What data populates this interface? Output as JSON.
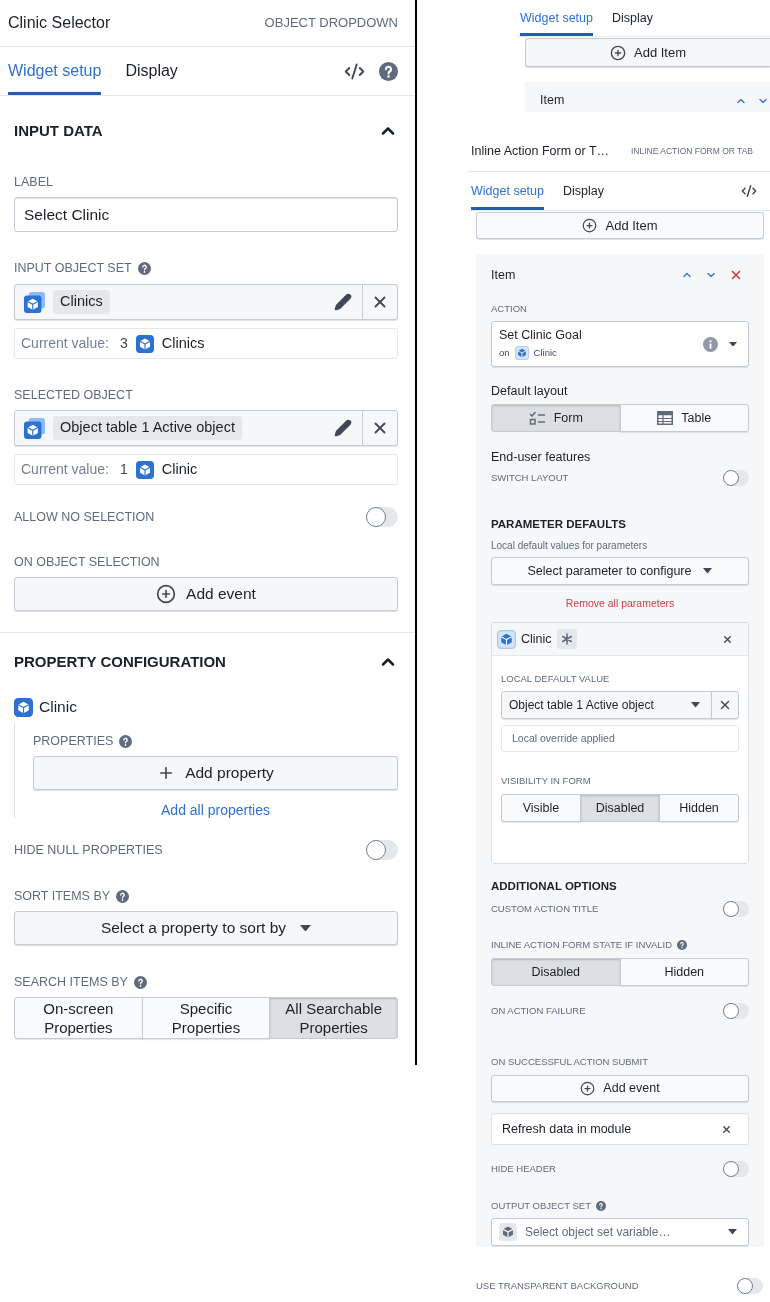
{
  "object_dropdown_panel": {
    "title": "Clinic Selector",
    "widget_type": "OBJECT DROPDOWN",
    "tabs": [
      {
        "label": "Widget setup",
        "selected": true
      },
      {
        "label": "Display",
        "selected": false
      }
    ],
    "input_data": {
      "heading": "INPUT DATA",
      "expanded": true,
      "label_field": {
        "label": "LABEL",
        "value": "Select Clinic"
      },
      "input_object_set": {
        "label": "INPUT OBJECT SET",
        "chip": "Clinics",
        "current_value_label": "Current value:",
        "current_count": "3",
        "current_object": "Clinics"
      },
      "selected_object": {
        "label": "SELECTED OBJECT",
        "chip": "Object table 1 Active object",
        "current_value_label": "Current value:",
        "current_count": "1",
        "current_object": "Clinic"
      },
      "allow_no_selection": {
        "label": "ALLOW NO SELECTION",
        "on": false
      },
      "on_object_selection": {
        "label": "ON OBJECT SELECTION",
        "button": "Add event"
      }
    },
    "property_configuration": {
      "heading": "PROPERTY CONFIGURATION",
      "expanded": true,
      "object_type": "Clinic",
      "properties_label": "PROPERTIES",
      "add_property_button": "Add property",
      "add_all_link": "Add all properties",
      "hide_null_properties": {
        "label": "HIDE NULL PROPERTIES",
        "on": false
      },
      "sort_items_by": {
        "label": "SORT ITEMS BY",
        "button": "Select a property to sort by"
      },
      "search_items_by": {
        "label": "SEARCH ITEMS BY",
        "options": [
          {
            "label": "On-screen Properties",
            "selected": false
          },
          {
            "label": "Specific Properties",
            "selected": false
          },
          {
            "label": "All Searchable Properties",
            "selected": true
          }
        ]
      }
    }
  },
  "partial_panel": {
    "tabs": [
      {
        "label": "Widget setup",
        "selected": true
      },
      {
        "label": "Display",
        "selected": false
      }
    ],
    "add_button": "Add Item",
    "item_title": "Item"
  },
  "action_form_panel": {
    "title": "Inline Action Form or T…",
    "widget_type": "INLINE ACTION FORM OR TAB",
    "tabs": [
      {
        "label": "Widget setup",
        "selected": true
      },
      {
        "label": "Display",
        "selected": false
      }
    ],
    "add_button": "Add Item",
    "item": {
      "title": "Item",
      "action": {
        "label": "ACTION",
        "name": "Set Clinic Goal",
        "on_label": "on",
        "object": "Clinic"
      },
      "default_layout": {
        "label": "Default layout",
        "options": [
          {
            "kind": "form",
            "label": "Form",
            "selected": true
          },
          {
            "kind": "table",
            "label": "Table",
            "selected": false
          }
        ]
      },
      "end_user_features": {
        "heading": "End-user features",
        "switch_layout": {
          "label": "SWITCH LAYOUT",
          "on": false
        }
      },
      "parameter_defaults": {
        "heading": "PARAMETER DEFAULTS",
        "description": "Local default values for parameters",
        "select_button": "Select parameter to configure",
        "remove_link": "Remove all parameters",
        "parameters": [
          {
            "name": "Clinic",
            "default_label": "LOCAL DEFAULT VALUE",
            "default_value": "Object table 1 Active object",
            "note": "Local override applied",
            "visibility_label": "VISIBILITY IN FORM",
            "visibility_options": [
              {
                "label": "Visible",
                "selected": false
              },
              {
                "label": "Disabled",
                "selected": true
              },
              {
                "label": "Hidden",
                "selected": false
              }
            ]
          }
        ]
      },
      "additional_options": {
        "heading": "ADDITIONAL OPTIONS",
        "custom_action_title": {
          "label": "CUSTOM ACTION TITLE",
          "on": false
        },
        "invalid_state": {
          "label": "INLINE ACTION FORM STATE IF INVALID",
          "options": [
            {
              "label": "Disabled",
              "selected": true
            },
            {
              "label": "Hidden",
              "selected": false
            }
          ]
        },
        "on_action_failure": {
          "label": "ON ACTION FAILURE",
          "on": false
        },
        "on_successful_submit": {
          "label": "ON SUCCESSFUL ACTION SUBMIT",
          "button": "Add event",
          "events": [
            "Refresh data in module"
          ]
        },
        "hide_header": {
          "label": "HIDE HEADER",
          "on": false
        },
        "output_object_set": {
          "label": "OUTPUT OBJECT SET",
          "placeholder": "Select object set variable…"
        }
      }
    },
    "transparent_background": {
      "label": "USE TRANSPARENT BACKGROUND",
      "on": false
    }
  }
}
